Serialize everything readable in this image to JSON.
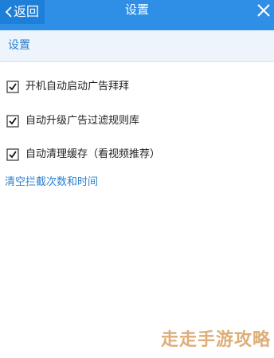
{
  "header": {
    "back_label": "返回",
    "title": "设置",
    "colors": {
      "bar": "#2f8fe6",
      "back_bg": "#1e7fd8"
    },
    "icons": {
      "back": "chevron-left-icon",
      "close": "close-icon"
    }
  },
  "section": {
    "title": "设置"
  },
  "options": [
    {
      "label": "开机自动启动广告拜拜",
      "checked": true
    },
    {
      "label": "自动升级广告过滤规则库",
      "checked": true
    },
    {
      "label": "自动清理缓存（看视频推荐）",
      "checked": true
    }
  ],
  "clear_link": "清空拦截次数和时间",
  "watermark": "走走手游攻略"
}
